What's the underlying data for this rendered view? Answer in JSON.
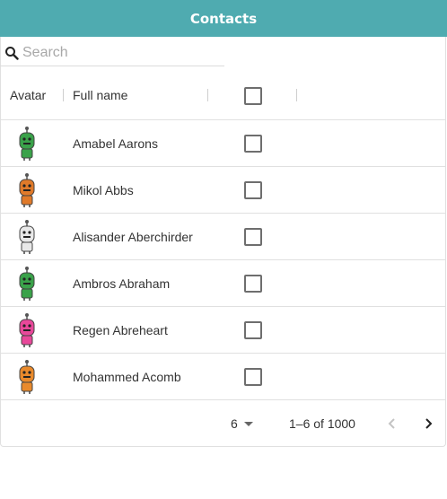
{
  "header": {
    "title": "Contacts",
    "color": "#4fabb0"
  },
  "search": {
    "placeholder": "Search",
    "value": ""
  },
  "table": {
    "columns": {
      "avatar": "Avatar",
      "full_name": "Full name"
    },
    "rows": [
      {
        "name": "Amabel Aarons",
        "avatar_color": "#3aa24a",
        "avatar_icon": "robot-avatar-green",
        "checked": false
      },
      {
        "name": "Mikol Abbs",
        "avatar_color": "#e07a2a",
        "avatar_icon": "robot-avatar-orange",
        "checked": false
      },
      {
        "name": "Alisander Aberchirder",
        "avatar_color": "#e8e8e8",
        "avatar_icon": "robot-avatar-white",
        "checked": false
      },
      {
        "name": "Ambros Abraham",
        "avatar_color": "#3aa24a",
        "avatar_icon": "robot-avatar-green",
        "checked": false
      },
      {
        "name": "Regen Abreheart",
        "avatar_color": "#e8489a",
        "avatar_icon": "robot-avatar-pink",
        "checked": false
      },
      {
        "name": "Mohammed Acomb",
        "avatar_color": "#e98a2c",
        "avatar_icon": "robot-avatar-orange",
        "checked": false
      }
    ]
  },
  "pagination": {
    "rows_per_page": "6",
    "range_label": "1–6 of 1000",
    "prev_icon": "chevron-left-icon",
    "next_icon": "chevron-right-icon"
  }
}
